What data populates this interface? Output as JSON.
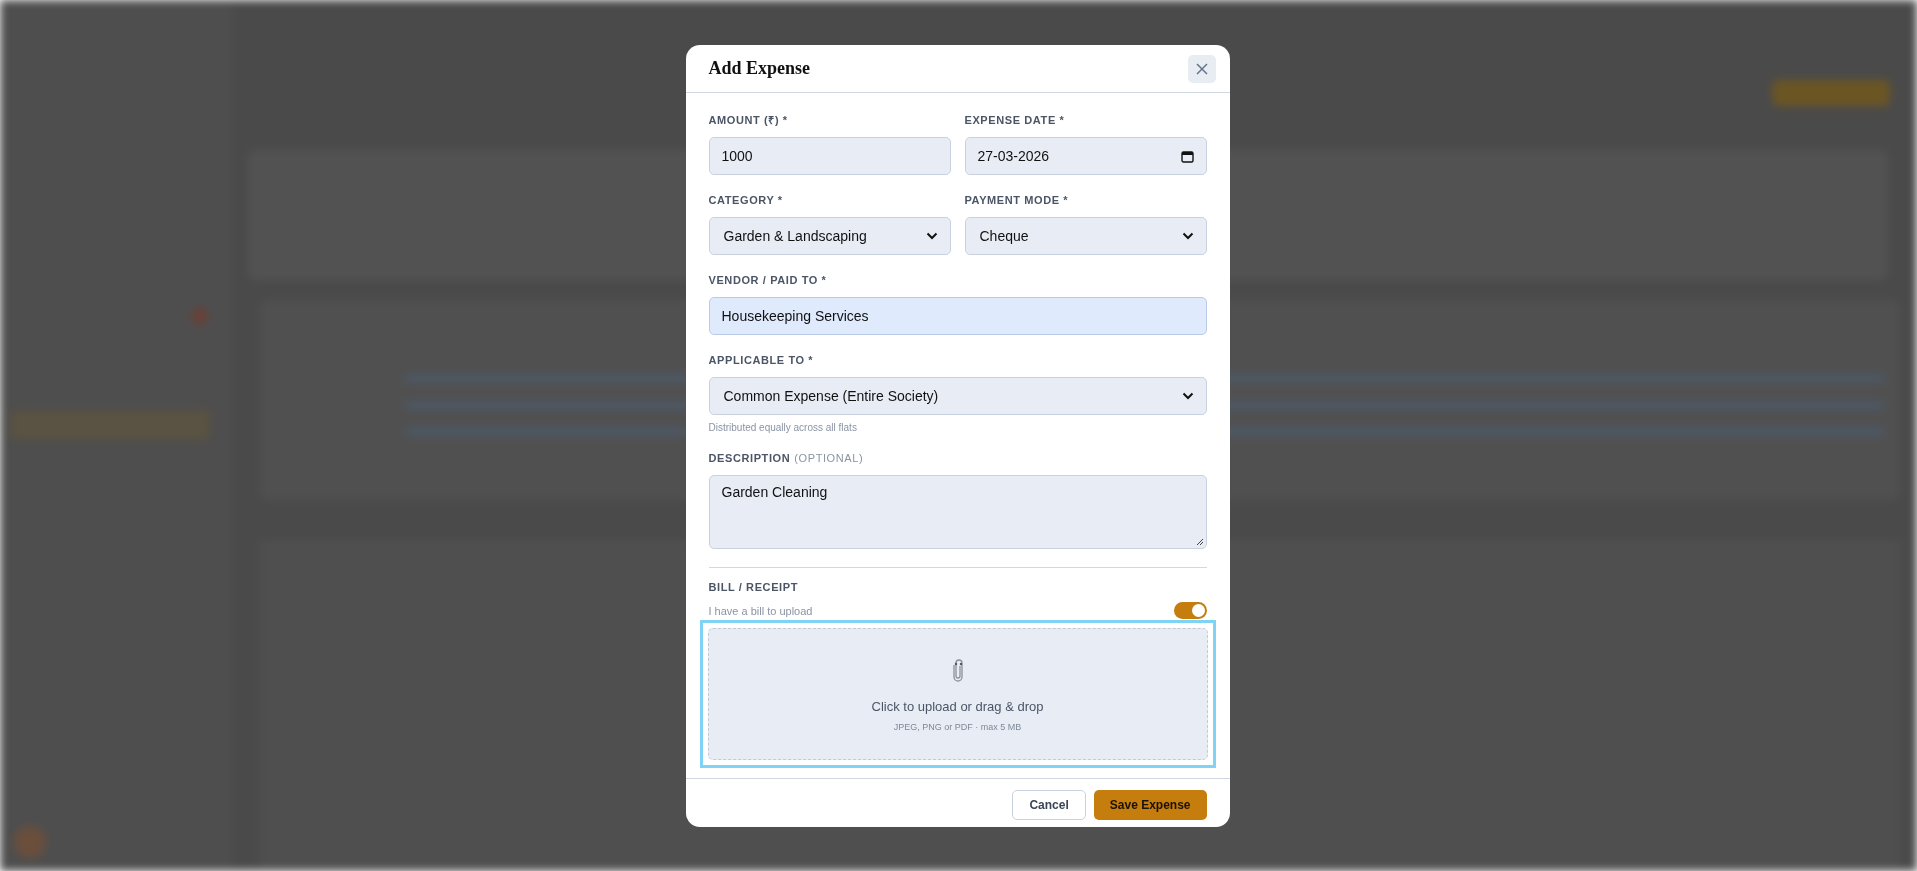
{
  "dialog": {
    "title": "Add Expense",
    "fields": [
      {
        "kind": "text",
        "label": "AMOUNT (₹) *",
        "value": "1000",
        "half": true
      },
      {
        "kind": "date",
        "label": "EXPENSE DATE *",
        "value": "27-03-2026",
        "half": true
      },
      {
        "kind": "select",
        "label": "CATEGORY *",
        "value": "Garden & Landscaping",
        "half": true
      },
      {
        "kind": "select",
        "label": "PAYMENT MODE *",
        "value": "Cheque",
        "half": true
      },
      {
        "kind": "text",
        "label": "VENDOR / PAID TO *",
        "value": "Housekeeping Services",
        "half": false,
        "autofilled": true
      },
      {
        "kind": "select",
        "label": "APPLICABLE TO *",
        "value": "Common Expense (Entire Society)",
        "half": false,
        "hint": "Distributed equally across all flats"
      },
      {
        "kind": "textarea",
        "label": "DESCRIPTION",
        "label_note": "(OPTIONAL)",
        "value": "Garden Cleaning",
        "half": false
      }
    ],
    "bill": {
      "heading": "BILL / RECEIPT",
      "toggle_label": "I have a bill to upload",
      "on": true,
      "dropzone": {
        "focused": true,
        "text": "Click to upload or drag & drop",
        "hint": "JPEG, PNG or PDF · max 5 MB"
      }
    },
    "buttons": [
      {
        "kind": "secondary",
        "label": "Cancel"
      },
      {
        "kind": "primary",
        "label": "Save Expense"
      }
    ]
  }
}
